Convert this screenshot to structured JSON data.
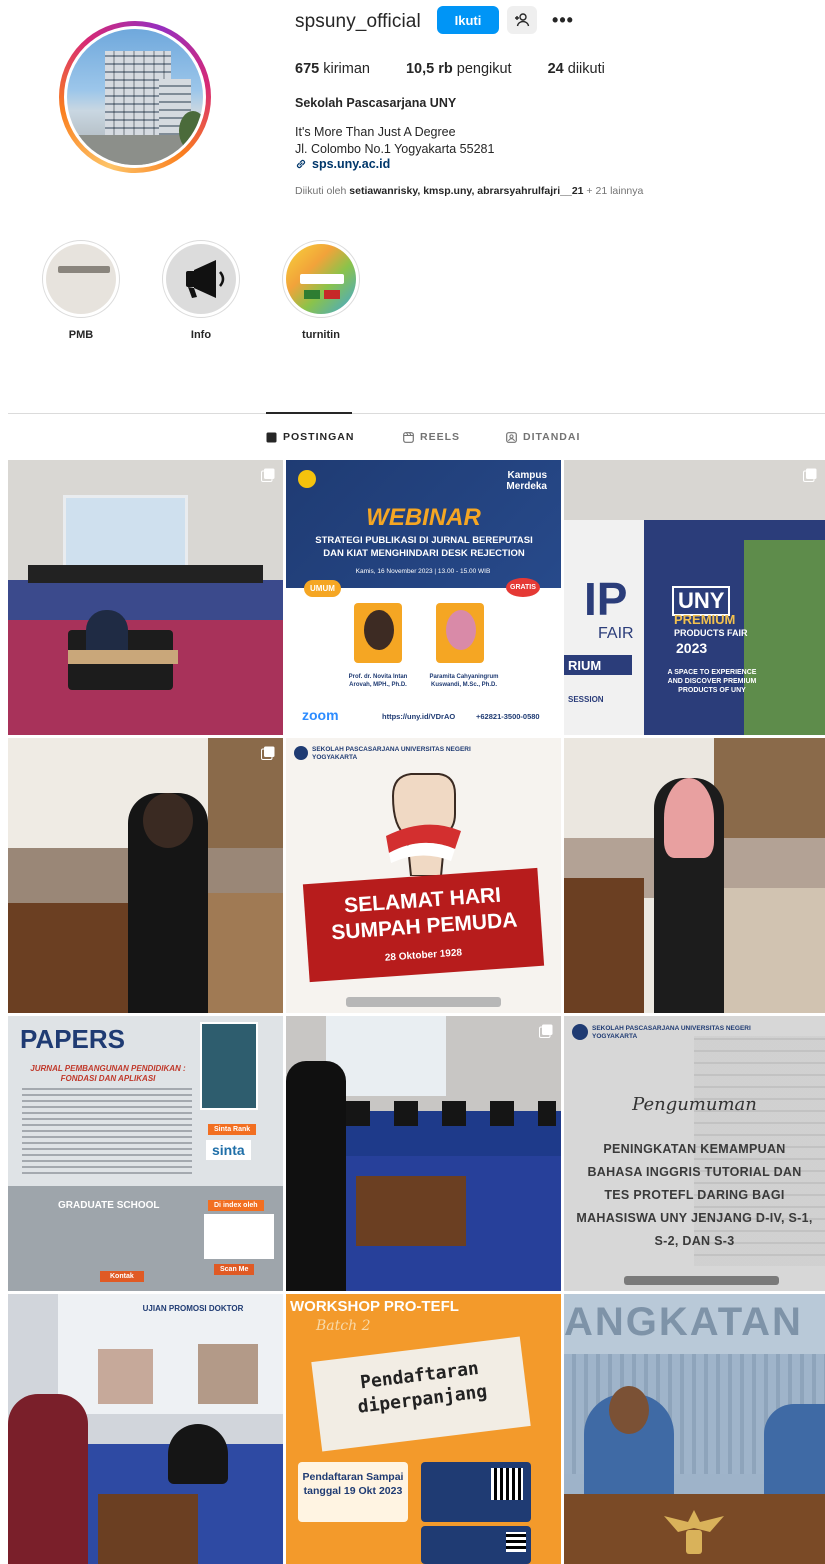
{
  "profile": {
    "username": "spsuny_official",
    "follow_label": "Ikuti",
    "stats": [
      {
        "count": "675",
        "label": "kiriman"
      },
      {
        "count": "10,5 rb",
        "label": "pengikut"
      },
      {
        "count": "24",
        "label": "diikuti"
      }
    ],
    "full_name": "Sekolah Pascasarjana UNY",
    "bio_line1": "It's More Than Just A Degree",
    "bio_line2": "Jl. Colombo No.1 Yogyakarta 55281",
    "link": "sps.uny.ac.id",
    "followed_prefix": "Diikuti oleh ",
    "followed_names": "setiawanrisky, kmsp.uny, abrarsyahrulfajri__21",
    "followed_suffix": " + 21 lainnya"
  },
  "highlights": [
    {
      "label": "PMB"
    },
    {
      "label": "Info"
    },
    {
      "label": "turnitin"
    }
  ],
  "tabs": [
    {
      "label": "POSTINGAN",
      "icon": "grid-icon",
      "active": true
    },
    {
      "label": "REELS",
      "icon": "reels-icon",
      "active": false
    },
    {
      "label": "DITANDAI",
      "icon": "tagged-icon",
      "active": false
    }
  ],
  "posts": [
    {
      "id": 1,
      "kind": "photo",
      "multi": true
    },
    {
      "id": 2,
      "kind": "graphic",
      "multi": false,
      "title": "WEBINAR",
      "subtitle": "STRATEGI PUBLIKASI DI JURNAL BEREPUTASI DAN KIAT MENGHINDARI DESK REJECTION",
      "badge": "Kampus Merdeka",
      "tag1": "UMUM",
      "tag2": "GRATIS",
      "schedule": "Kamis, 16 November 2023 | 13.00 - 15.00 WIB",
      "speaker1": "Prof. dr. Novita Intan Arovah, MPH., Ph.D.",
      "speaker2": "Paramita Cahyaningrum Kuswandi, M.Sc., Ph.D.",
      "zoom": "zoom",
      "url": "https://uny.id/VDrAO",
      "phone": "+62821-3500-0580"
    },
    {
      "id": 3,
      "kind": "photo",
      "multi": true,
      "line1": "UNY",
      "line2": "PREMIUM",
      "line3": "PRODUCTS FAIR",
      "line4": "2023",
      "line5": "A SPACE TO EXPERIENCE AND DISCOVER PREMIUM PRODUCTS OF UNY",
      "fair": "FAIR",
      "rium": "RIUM",
      "session": "SESSION",
      "ip": "IP"
    },
    {
      "id": 4,
      "kind": "photo",
      "multi": true
    },
    {
      "id": 5,
      "kind": "graphic",
      "multi": false,
      "header": "SEKOLAH PASCASARJANA UNIVERSITAS NEGERI YOGYAKARTA",
      "title": "SELAMAT HARI SUMPAH PEMUDA",
      "date": "28 Oktober 1928"
    },
    {
      "id": 6,
      "kind": "photo",
      "multi": false
    },
    {
      "id": 7,
      "kind": "graphic",
      "multi": false,
      "title": "PAPERS",
      "subtitle": "JURNAL PEMBANGUNAN PENDIDIKAN : FONDASI DAN APLIKASI",
      "sinta": "Sinta Rank",
      "sinta_logo": "sinta",
      "school": "GRADUATE SCHOOL",
      "indexed": "Di index oleh",
      "contact": "Kontak",
      "scan": "Scan Me"
    },
    {
      "id": 8,
      "kind": "photo",
      "multi": true
    },
    {
      "id": 9,
      "kind": "graphic",
      "multi": false,
      "header": "SEKOLAH PASCASARJANA UNIVERSITAS NEGERI YOGYAKARTA",
      "script": "Pengumuman",
      "title": "PENINGKATAN KEMAMPUAN BAHASA INGGRIS TUTORIAL DAN TES PROTEFL DARING BAGI MAHASISWA UNY JENJANG D-IV, S-1, S-2, DAN S-3"
    },
    {
      "id": 10,
      "kind": "photo",
      "multi": false,
      "screen_title": "UJIAN PROMOSI DOKTOR"
    },
    {
      "id": 11,
      "kind": "graphic",
      "multi": false,
      "title": "WORKSHOP PRO-TEFL",
      "batch": "Batch 2",
      "stamp": "Pendaftaran diperpanjang",
      "deadline": "Pendaftaran Sampai tanggal 19 Okt 2023"
    },
    {
      "id": 12,
      "kind": "photo",
      "multi": false,
      "sign": "ANGKATAN"
    }
  ],
  "colors": {
    "accent": "#0095f6",
    "link": "#00376b",
    "muted": "#737373",
    "navy": "#1f3b73",
    "orange": "#f39a2b"
  }
}
